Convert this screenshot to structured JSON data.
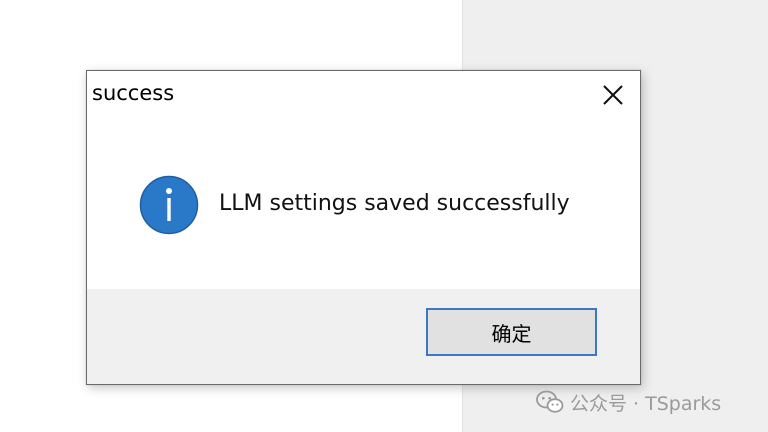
{
  "dialog": {
    "title": "success",
    "message": "LLM settings saved successfully",
    "ok_label": "确定",
    "icon": "info-icon",
    "close_icon": "close-icon"
  },
  "watermark": {
    "text": "公众号 · TSparks",
    "icon": "wechat-logo-icon"
  },
  "colors": {
    "info_blue": "#2a78c8",
    "button_border": "#3a78c4",
    "footer_bg": "#f0f0f0"
  }
}
